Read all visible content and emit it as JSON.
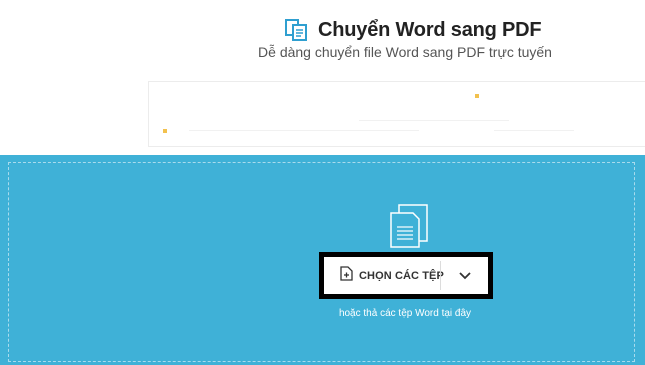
{
  "header": {
    "title": "Chuyển Word sang PDF",
    "subtitle": "Dễ dàng chuyển file Word sang PDF trực tuyến",
    "icon": "pdf-files-icon"
  },
  "dropzone": {
    "icon": "files-icon",
    "choose_button": {
      "label": "CHỌN CÁC TỆP",
      "icon": "add-file-icon"
    },
    "dropdown_icon": "chevron-down-icon",
    "hint": "hoặc thả các tệp Word tại đây"
  },
  "colors": {
    "brand": "#3fb1d7",
    "title_icon": "#2f9fd0",
    "text_dark": "#222222"
  }
}
